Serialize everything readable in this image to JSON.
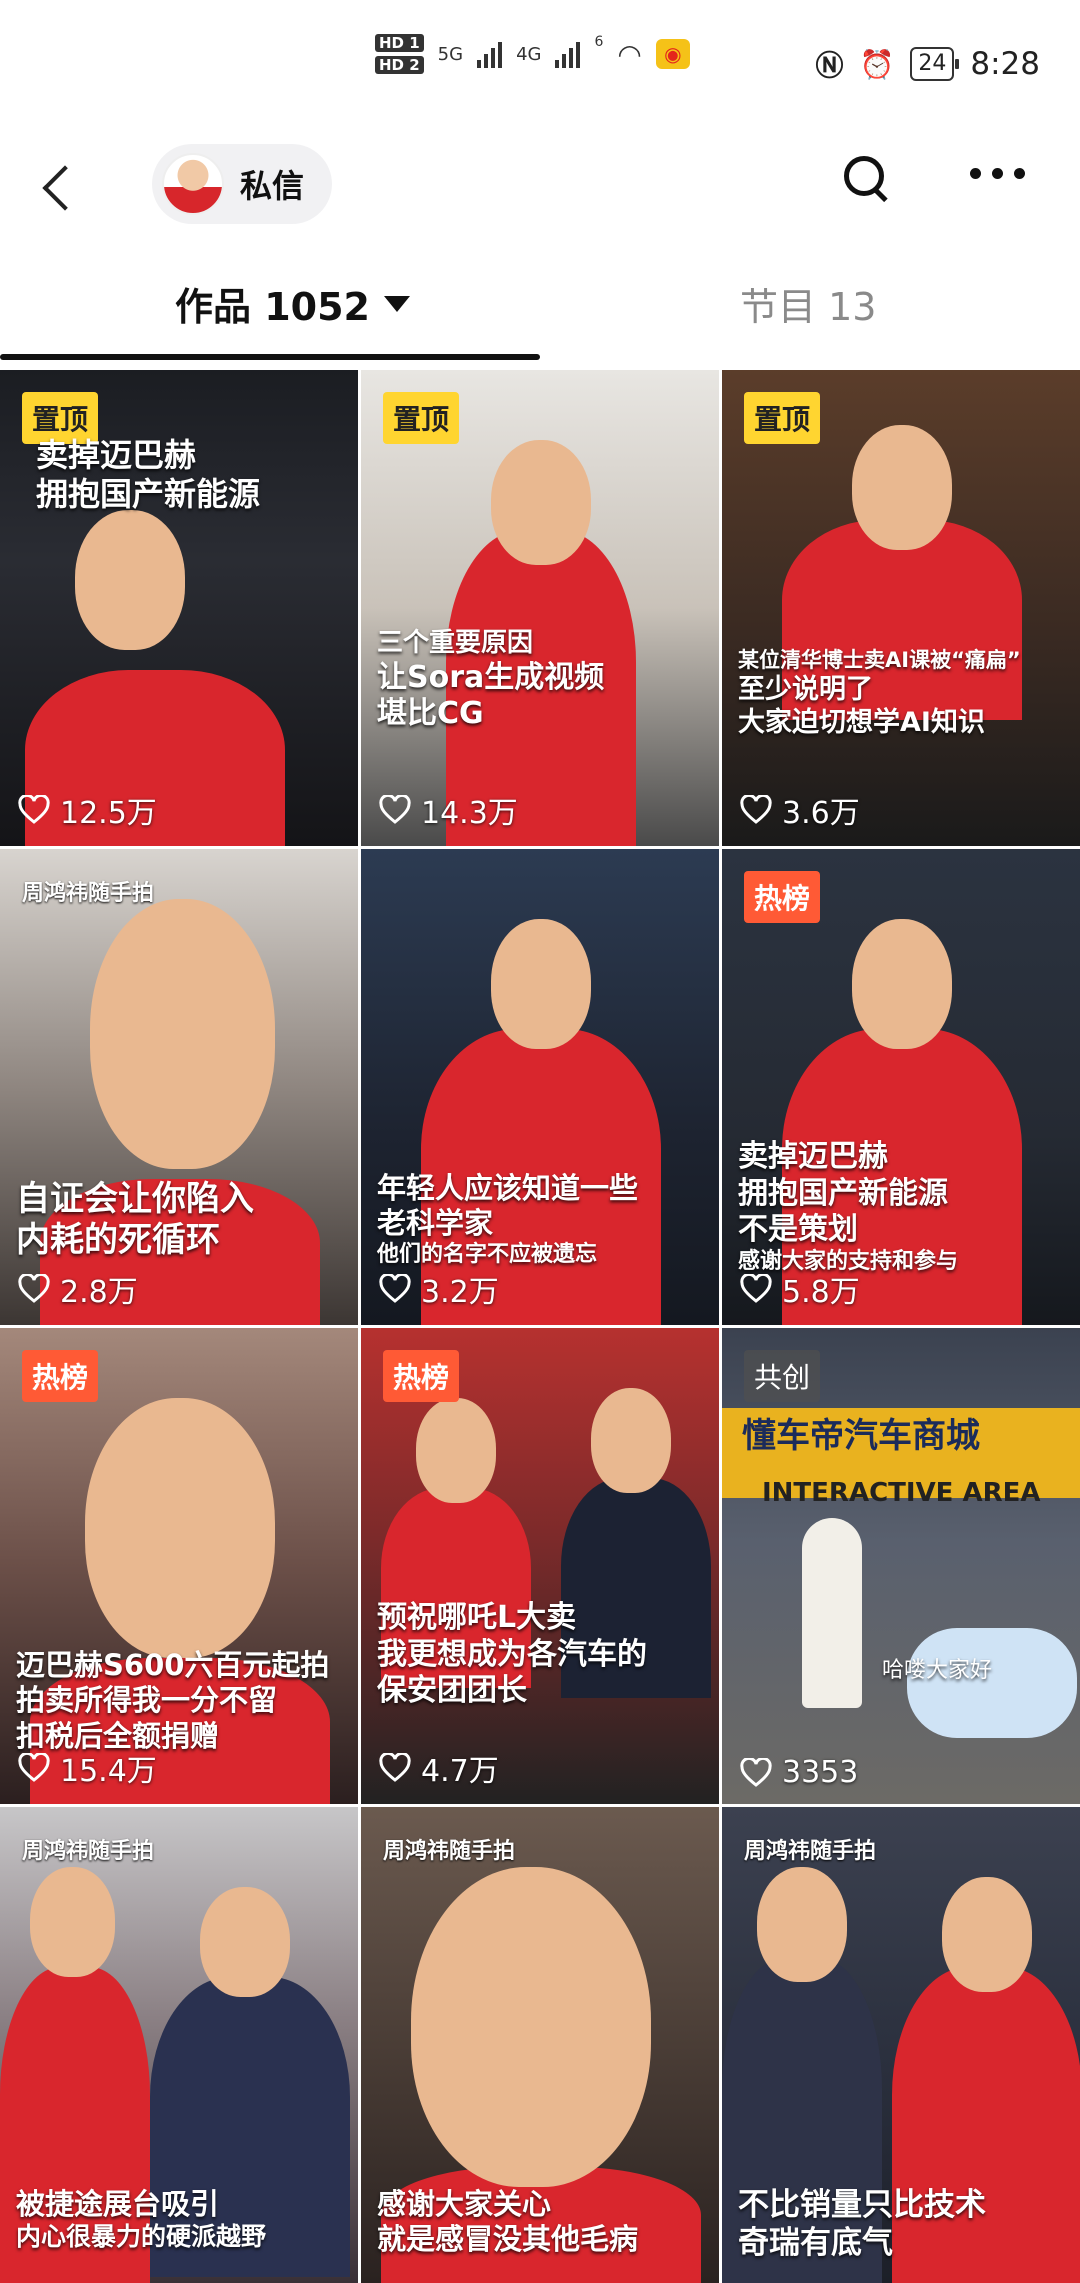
{
  "status": {
    "sim1": "HD 1",
    "sim2": "HD 2",
    "net1": "5G",
    "net2": "4G",
    "wifi_badge": "6",
    "battery": "24",
    "time": "8:28"
  },
  "header": {
    "chip_label": "私信"
  },
  "tabs": {
    "works_label": "作品 1052",
    "shows_label": "节目 13"
  },
  "videos": [
    {
      "badge": "置顶",
      "caption": [
        "卖掉迈巴赫",
        "拥抱国产新能源"
      ],
      "likes": "12.5万"
    },
    {
      "badge": "置顶",
      "caption": [
        "三个重要原因",
        "让Sora生成视频",
        "堪比CG"
      ],
      "likes": "14.3万"
    },
    {
      "badge": "置顶",
      "caption": [
        "某位清华博士卖AI课被“痛扁”",
        "至少说明了",
        "大家迫切想学AI知识"
      ],
      "likes": "3.6万"
    },
    {
      "tag": "周鸿祎随手拍",
      "caption": [
        "自证会让你陷入",
        "内耗的死循环"
      ],
      "likes": "2.8万"
    },
    {
      "caption": [
        "年轻人应该知道一些",
        "老科学家",
        "他们的名字不应被遗忘"
      ],
      "likes": "3.2万"
    },
    {
      "badge": "热榜",
      "caption": [
        "卖掉迈巴赫",
        "拥抱国产新能源",
        "不是策划",
        "感谢大家的支持和参与"
      ],
      "likes": "5.8万"
    },
    {
      "badge": "热榜",
      "caption": [
        "迈巴赫S600六百元起拍",
        "拍卖所得我一分不留",
        "扣税后全额捐赠"
      ],
      "likes": "15.4万"
    },
    {
      "badge": "热榜",
      "caption": [
        "预祝哪吒L大卖",
        "我更想成为各汽车的",
        "保安团团长"
      ],
      "likes": "4.7万"
    },
    {
      "badge": "共创",
      "caption": [
        "懂车帝汽车商城",
        "INTERACTIVE AREA",
        "哈喽大家好"
      ],
      "likes": "3353"
    },
    {
      "tag": "周鸿祎随手拍",
      "caption": [
        "被捷途展台吸引",
        "内心很暴力的硬派越野"
      ]
    },
    {
      "tag": "周鸿祎随手拍",
      "caption": [
        "感谢大家关心",
        "就是感冒没其他毛病"
      ]
    },
    {
      "tag": "周鸿祎随手拍",
      "caption": [
        "不比销量只比技术",
        "奇瑞有底气"
      ]
    }
  ],
  "colors": {
    "accent_red": "#d9262d",
    "badge_yellow": "#ffd530",
    "badge_hot": "#ff5a35"
  }
}
